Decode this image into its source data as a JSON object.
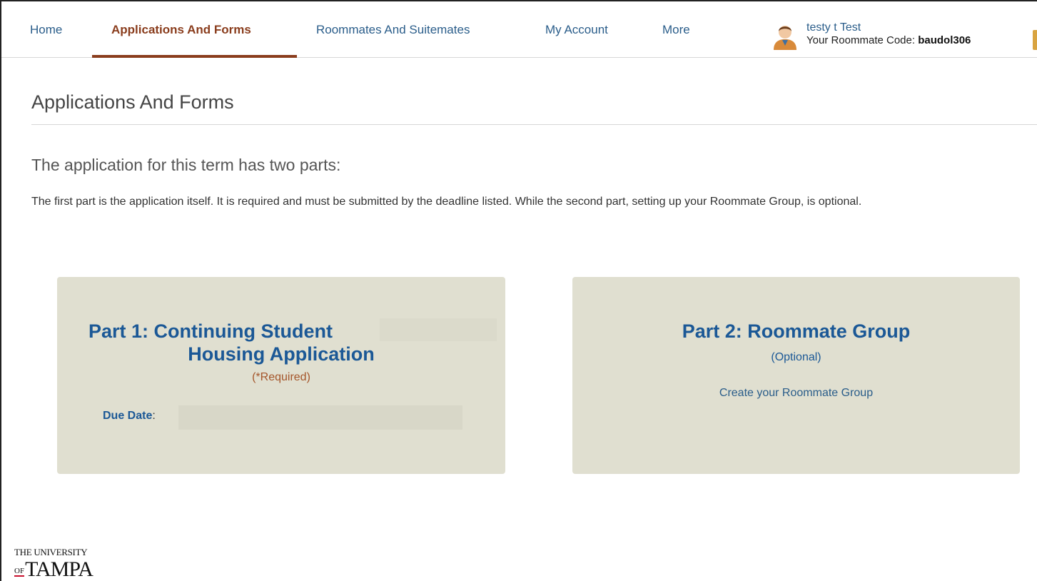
{
  "nav": {
    "items": [
      {
        "label": "Home"
      },
      {
        "label": "Applications And Forms",
        "active": true
      },
      {
        "label": "Roommates And Suitemates"
      },
      {
        "label": "My Account"
      },
      {
        "label": "More"
      }
    ],
    "accent_color": "#8a3d1d"
  },
  "user": {
    "name": "testy t Test",
    "code_label": "Your Roommate Code: ",
    "code": "baudol306",
    "avatar_icon": "user-avatar-icon"
  },
  "page": {
    "title": "Applications And Forms",
    "intro_heading": "The application for this term has two parts:",
    "intro_text": "The first part is the application itself. It is required and must be submitted by the deadline listed. While the second part, setting up your Roommate Group, is optional."
  },
  "cards": {
    "part1": {
      "title_line1": "Part 1: Continuing Student",
      "title_line2": "Housing Application",
      "required": "(*Required)",
      "due_label": "Due Date",
      "due_colon": ":"
    },
    "part2": {
      "title": "Part 2: Roommate Group",
      "optional": "(Optional)",
      "link": "Create your Roommate Group"
    },
    "background_color": "#e0dfd0",
    "title_color": "#1b5896"
  },
  "logo": {
    "line1": "THE UNIVERSITY",
    "of": "OF",
    "name": "TAMPA"
  }
}
